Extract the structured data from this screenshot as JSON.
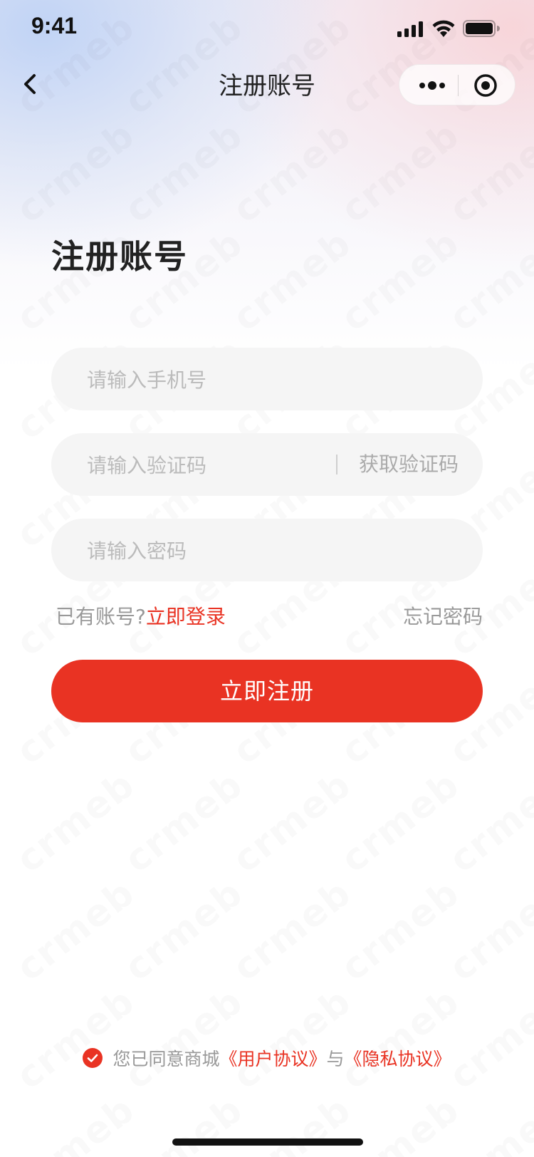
{
  "status_bar": {
    "time": "9:41",
    "signal_icon": "cellular-signal-icon",
    "wifi_icon": "wifi-icon",
    "battery_icon": "battery-icon"
  },
  "nav": {
    "back_icon": "chevron-left-icon",
    "title": "注册账号",
    "capsule_more_icon": "more-dots-icon",
    "capsule_close_icon": "target-circle-icon"
  },
  "heading": "注册账号",
  "form": {
    "phone_placeholder": "请输入手机号",
    "code_placeholder": "请输入验证码",
    "get_code_label": "获取验证码",
    "password_placeholder": "请输入密码"
  },
  "links": {
    "has_account": "已有账号?",
    "login": "立即登录",
    "forgot": "忘记密码"
  },
  "submit_label": "立即注册",
  "agreement": {
    "checked": true,
    "prefix": "您已同意商城",
    "user_agreement": "《用户协议》",
    "and": "与",
    "privacy_agreement": "《隐私协议》"
  },
  "watermark_text": "crmeb",
  "colors": {
    "accent": "#e93323",
    "input_bg": "#f5f5f5",
    "placeholder": "#bbbbbb",
    "muted_text": "#999999"
  }
}
